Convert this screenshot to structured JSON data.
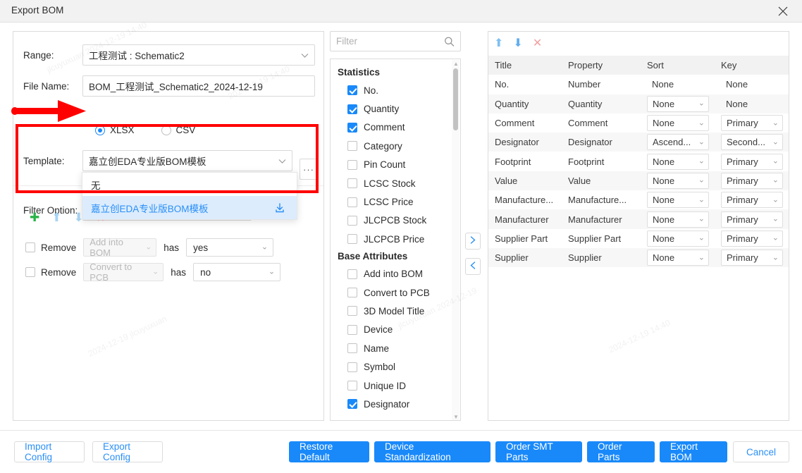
{
  "window": {
    "title": "Export BOM",
    "close_icon": "close-icon"
  },
  "left_form": {
    "range_label": "Range:",
    "range_value": "工程测试 : Schematic2",
    "filename_label": "File Name:",
    "filename_value": "BOM_工程测试_Schematic2_2024-12-19",
    "format_options": [
      {
        "label": "XLSX",
        "selected": true
      },
      {
        "label": "CSV",
        "selected": false
      }
    ],
    "template_label": "Template:",
    "template_value": "嘉立创EDA专业版BOM模板",
    "template_more_label": "···",
    "filter_option_label": "Filter Option:",
    "dropdown": {
      "open": true,
      "items": [
        {
          "label": "无",
          "selected": false,
          "has_download": false
        },
        {
          "label": "嘉立创EDA专业版BOM模板",
          "selected": true,
          "has_download": true
        }
      ]
    },
    "toolbar_icons": [
      {
        "name": "add-filter-icon",
        "glyph": "✚",
        "color": "#2bb34a"
      },
      {
        "name": "move-up-icon",
        "glyph": "⬆",
        "color": "#a8d4f5"
      },
      {
        "name": "move-down-icon",
        "glyph": "⬇",
        "color": "#a8d4f5"
      },
      {
        "name": "delete-filter-icon",
        "glyph": "✖",
        "color": "#f5b0b0"
      }
    ],
    "filter_rules": [
      {
        "checked": false,
        "remove_label": "Remove",
        "attribute": "Add into BOM",
        "has_label": "has",
        "value": "yes"
      },
      {
        "checked": false,
        "remove_label": "Remove",
        "attribute": "Convert to PCB",
        "has_label": "has",
        "value": "no"
      }
    ]
  },
  "attributes_panel": {
    "filter_placeholder": "Filter",
    "search_icon": "search-icon",
    "groups": [
      {
        "title": "Statistics",
        "items": [
          {
            "label": "No.",
            "checked": true
          },
          {
            "label": "Quantity",
            "checked": true
          },
          {
            "label": "Comment",
            "checked": true
          },
          {
            "label": "Category",
            "checked": false
          },
          {
            "label": "Pin Count",
            "checked": false
          },
          {
            "label": "LCSC Stock",
            "checked": false
          },
          {
            "label": "LCSC Price",
            "checked": false
          },
          {
            "label": "JLCPCB Stock",
            "checked": false
          },
          {
            "label": "JLCPCB Price",
            "checked": false
          }
        ]
      },
      {
        "title": "Base Attributes",
        "items": [
          {
            "label": "Add into BOM",
            "checked": false
          },
          {
            "label": "Convert to PCB",
            "checked": false
          },
          {
            "label": "3D Model Title",
            "checked": false
          },
          {
            "label": "Device",
            "checked": false
          },
          {
            "label": "Name",
            "checked": false
          },
          {
            "label": "Symbol",
            "checked": false
          },
          {
            "label": "Unique ID",
            "checked": false
          },
          {
            "label": "Designator",
            "checked": true
          }
        ]
      }
    ]
  },
  "transfer": {
    "add_icon": "chevron-right-icon",
    "remove_icon": "chevron-left-icon"
  },
  "columns_panel": {
    "toolbar": [
      {
        "name": "move-up-icon",
        "glyph": "⬆"
      },
      {
        "name": "move-down-icon",
        "glyph": "⬇"
      },
      {
        "name": "delete-icon",
        "glyph": "✕"
      }
    ],
    "headers": [
      "Title",
      "Property",
      "Sort",
      "Key"
    ],
    "rows": [
      {
        "title": "No.",
        "property": "Number",
        "sort": "None",
        "sort_select": false,
        "key": "None",
        "key_select": false
      },
      {
        "title": "Quantity",
        "property": "Quantity",
        "sort": "None",
        "sort_select": true,
        "key": "None",
        "key_select": false
      },
      {
        "title": "Comment",
        "property": "Comment",
        "sort": "None",
        "sort_select": true,
        "key": "Primary",
        "key_select": true
      },
      {
        "title": "Designator",
        "property": "Designator",
        "sort": "Ascend...",
        "sort_select": true,
        "key": "Second...",
        "key_select": true
      },
      {
        "title": "Footprint",
        "property": "Footprint",
        "sort": "None",
        "sort_select": true,
        "key": "Primary",
        "key_select": true
      },
      {
        "title": "Value",
        "property": "Value",
        "sort": "None",
        "sort_select": true,
        "key": "Primary",
        "key_select": true
      },
      {
        "title": "Manufacture...",
        "property": "Manufacture...",
        "sort": "None",
        "sort_select": true,
        "key": "Primary",
        "key_select": true
      },
      {
        "title": "Manufacturer",
        "property": "Manufacturer",
        "sort": "None",
        "sort_select": true,
        "key": "Primary",
        "key_select": true
      },
      {
        "title": "Supplier Part",
        "property": "Supplier Part",
        "sort": "None",
        "sort_select": true,
        "key": "Primary",
        "key_select": true
      },
      {
        "title": "Supplier",
        "property": "Supplier",
        "sort": "None",
        "sort_select": true,
        "key": "Primary",
        "key_select": true
      }
    ]
  },
  "footer": {
    "left_buttons": [
      {
        "label": "Import Config",
        "style": "ghost"
      },
      {
        "label": "Export Config",
        "style": "ghost"
      }
    ],
    "right_buttons": [
      {
        "label": "Restore Default",
        "style": "primary"
      },
      {
        "label": "Device Standardization",
        "style": "primary"
      },
      {
        "label": "Order SMT Parts",
        "style": "primary"
      },
      {
        "label": "Order Parts",
        "style": "primary"
      },
      {
        "label": "Export BOM",
        "style": "primary"
      },
      {
        "label": "Cancel",
        "style": "cancel"
      }
    ]
  },
  "annotations": {
    "arrow_color": "#ff0000",
    "highlight_color": "#ff0000"
  },
  "colors": {
    "accent": "#1989fa",
    "link": "#2a8ff7",
    "header_bg": "#f2f2f2",
    "border": "#dcdcdc"
  }
}
